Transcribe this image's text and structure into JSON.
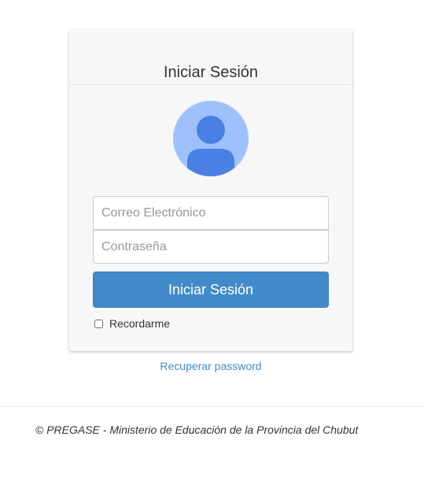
{
  "login": {
    "title": "Iniciar Sesión",
    "email_placeholder": "Correo Electrónico",
    "password_placeholder": "Contraseña",
    "submit_label": "Iniciar Sesión",
    "remember_label": "Recordarme",
    "remember_checked": false
  },
  "links": {
    "recover_password": "Recuperar password"
  },
  "footer": {
    "text": "© PREGASE - Ministerio de Educación de la Provincia del Chubut"
  },
  "icons": {
    "avatar": "user-avatar-icon"
  },
  "colors": {
    "primary": "#428bca",
    "avatar_bg": "#9ec1fd",
    "avatar_fg": "#4a7fe4",
    "card_bg": "#f7f7f7"
  }
}
